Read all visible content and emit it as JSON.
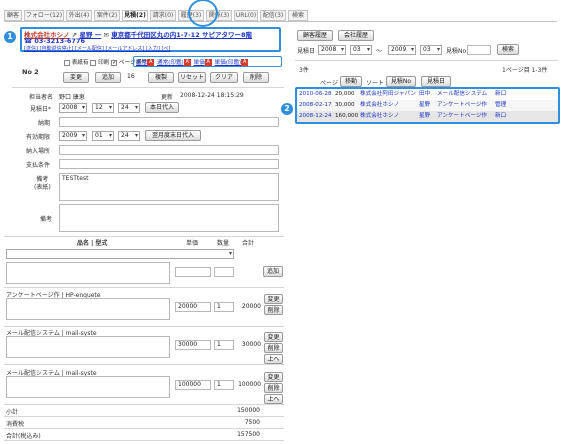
{
  "tabs": [
    {
      "label": "顧客",
      "active": false
    },
    {
      "label": "フォロー(12)",
      "active": false
    },
    {
      "label": "外出(4)",
      "active": false
    },
    {
      "label": "案件(2)",
      "active": false
    },
    {
      "label": "見積(2)",
      "active": true
    },
    {
      "label": "請求(0)",
      "active": false
    },
    {
      "label": "履歴(3)",
      "active": false
    },
    {
      "label": "関係(3)",
      "active": false
    },
    {
      "label": "URL(0)",
      "active": false
    },
    {
      "label": "配信(3)",
      "active": false
    },
    {
      "label": "検索",
      "active": false
    }
  ],
  "customer": {
    "company": "株式会社ホシノ",
    "contact": "星野 一",
    "address": "東京都千代田区丸の内1-7-12 サピアタワー8階",
    "phone": "03-3213-6776",
    "sublinks": "[送信] [自動返信停止] [メール配信] [メールアドレス] [入力] [ペ]"
  },
  "badges": {
    "left": "1",
    "right": "2"
  },
  "record": {
    "number": "No 2"
  },
  "checkboxes": {
    "display": "表紙有",
    "seal": "印刷",
    "pagenum": "ページ番号"
  },
  "pdf_links": [
    "通常",
    "通常(印鑑)",
    "単価",
    "単価(印鑑)"
  ],
  "actions": {
    "edit": "変更",
    "add": "追加",
    "count": "16",
    "copy": "複製",
    "reset": "リセット",
    "clear": "クリア",
    "delete": "削除"
  },
  "form": {
    "person_label": "担当者名",
    "person_value": "野口 康恵",
    "updated_label": "更新",
    "updated_value": "2008-12-24 18:15:29",
    "date_label": "見積日*",
    "date_year": "2008",
    "date_month": "12",
    "date_day": "24",
    "today_button": "本日代入",
    "deadline_label": "納期",
    "validity_label": "有効期限",
    "validity_year": "2009",
    "validity_month": "01",
    "validity_day": "24",
    "next_month_button": "翌月度末日代入",
    "delivery_label": "納入場所",
    "payment_label": "支払条件",
    "remarks_cover_label": "備考\n(表紙)",
    "remarks_cover_value": "TESTtest",
    "remarks_label": "備考"
  },
  "items_table": {
    "headers": {
      "name": "品名 | 型式",
      "price": "単価",
      "qty": "数量",
      "total": "合計"
    },
    "add_button": "追加",
    "rows": [
      {
        "name": "アンケートページ作 | HP-enquete",
        "price": "20000",
        "qty": "1",
        "total": "20000",
        "buttons": [
          "変更",
          "削除"
        ]
      },
      {
        "name": "メール配信システム | mail-syste",
        "price": "30000",
        "qty": "1",
        "total": "30000",
        "buttons": [
          "変更",
          "削除",
          "上へ"
        ]
      },
      {
        "name": "メール配信システム | mail-syste",
        "price": "100000",
        "qty": "1",
        "total": "100000",
        "buttons": [
          "変更",
          "削除",
          "上へ"
        ]
      }
    ],
    "subtotal_label": "小計",
    "subtotal_value": "150000",
    "tax_label": "消費税",
    "tax_value": "7500",
    "grand_label": "合計(税込み)",
    "grand_value": "157500"
  },
  "right_panel": {
    "history_button": "顧客履歴",
    "company_history_button": "会社履歴",
    "date_label": "見積日",
    "from_year": "2008",
    "from_month": "03",
    "tilde": "〜",
    "to_year": "2009",
    "to_month": "03",
    "number_label": "見積No",
    "search_button": "検索",
    "count": "3件",
    "page_info": "1ページ目 1-3件",
    "sort_prefix": "ページ",
    "move_button": "移動",
    "sort_label": "ソート",
    "sort_no_button": "見積No",
    "sort_date_button": "見積日",
    "results": [
      {
        "date": "2010-06-28",
        "amount": "20,000",
        "company": "株式会社阿田ジャパン",
        "person": "田中",
        "subject": "メール配信システム",
        "status": "新口"
      },
      {
        "date": "2008-02-17",
        "amount": "30,000",
        "company": "株式会社ホシノ",
        "person": "星野",
        "subject": "アンケートページ作",
        "status": "管理"
      },
      {
        "date": "2008-12-24",
        "amount": "160,000",
        "company": "株式会社ホシノ",
        "person": "星野",
        "subject": "アンケートページ作",
        "status": "新口"
      }
    ]
  },
  "colors": {
    "accent": "#2f8fde",
    "link": "#1d34c7",
    "pdf": "#d43b2a"
  }
}
